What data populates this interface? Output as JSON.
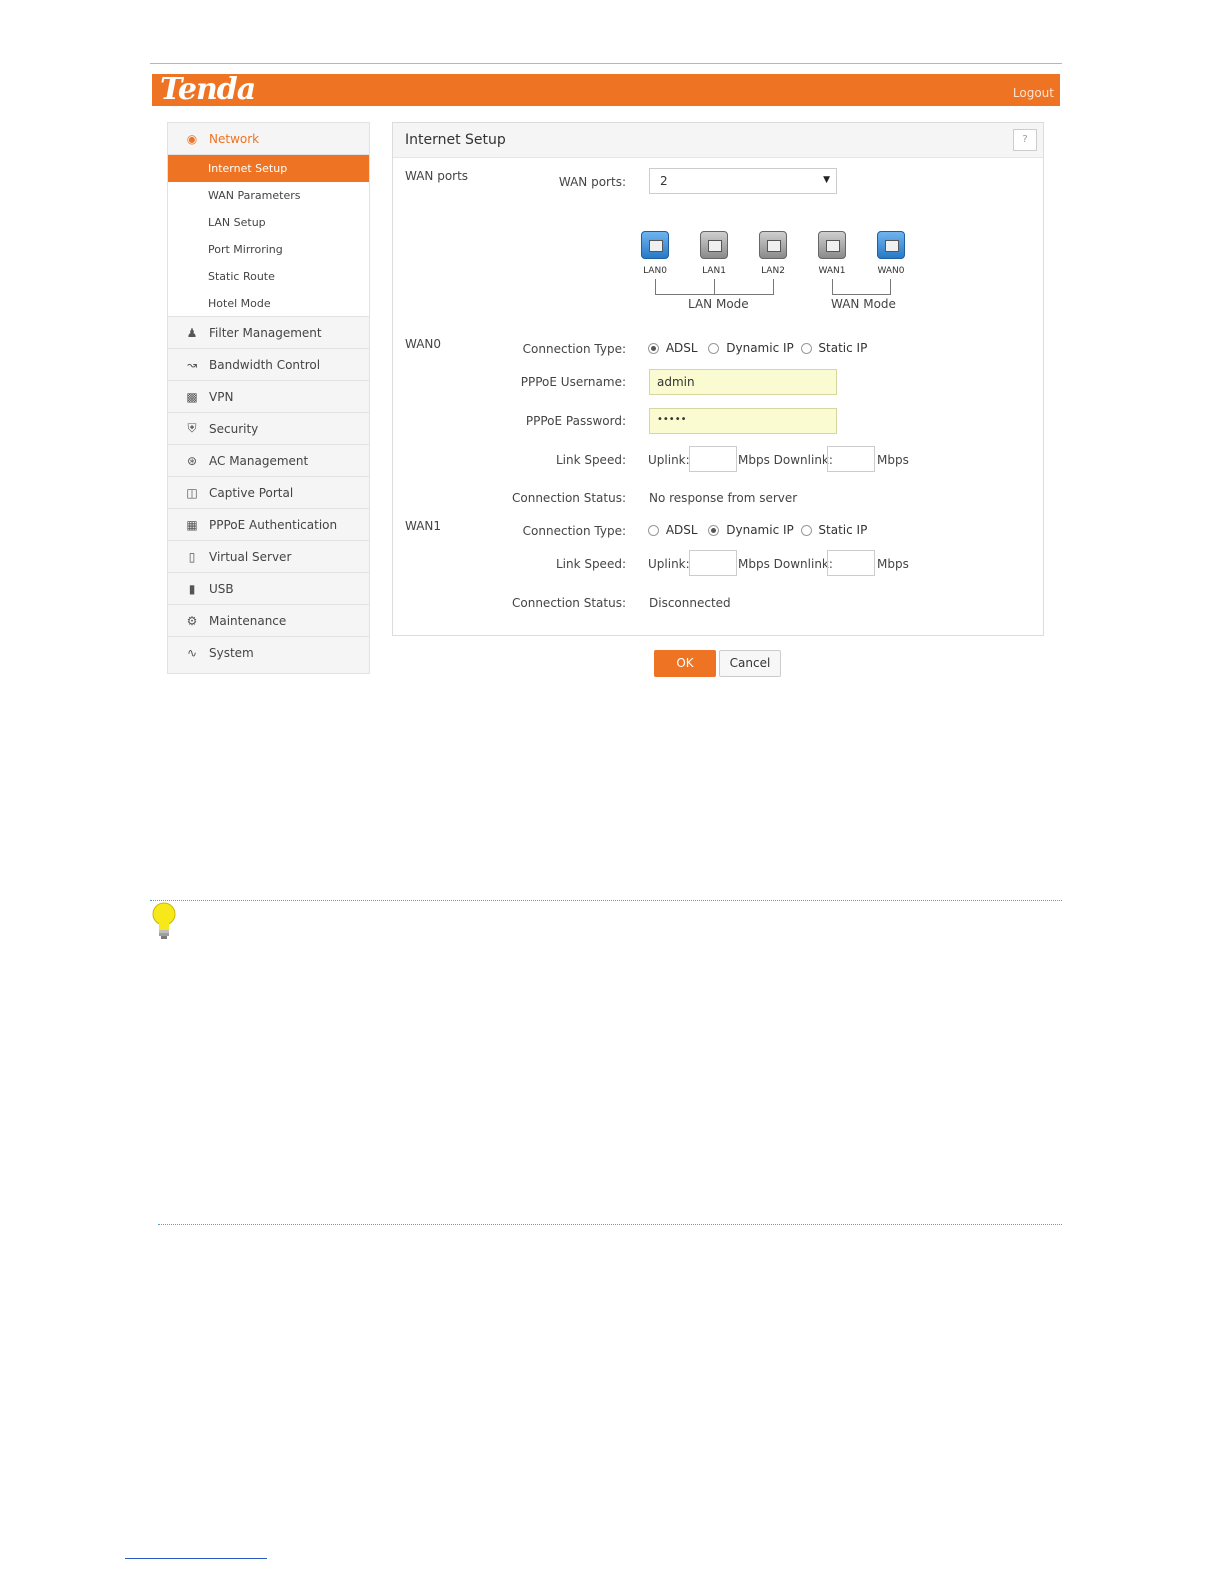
{
  "header": {
    "logo_text": "Tenda",
    "logout_label": "Logout",
    "accent_color": "#ee7322"
  },
  "sidebar": {
    "network": {
      "label": "Network",
      "icon": "globe-icon"
    },
    "network_items": [
      {
        "label": "Internet Setup",
        "active": true
      },
      {
        "label": "WAN Parameters"
      },
      {
        "label": "LAN Setup"
      },
      {
        "label": "Port Mirroring"
      },
      {
        "label": "Static Route"
      },
      {
        "label": "Hotel Mode"
      }
    ],
    "groups": [
      {
        "label": "Filter Management",
        "icon": "users-icon"
      },
      {
        "label": "Bandwidth Control",
        "icon": "chart-line-icon"
      },
      {
        "label": "VPN",
        "icon": "monitor-icon"
      },
      {
        "label": "Security",
        "icon": "shield-icon"
      },
      {
        "label": "AC Management",
        "icon": "satellite-icon"
      },
      {
        "label": "Captive Portal",
        "icon": "portal-icon"
      },
      {
        "label": "PPPoE Authentication",
        "icon": "auth-icon"
      },
      {
        "label": "Virtual Server",
        "icon": "server-icon"
      },
      {
        "label": "USB",
        "icon": "usb-icon"
      },
      {
        "label": "Maintenance",
        "icon": "gears-icon"
      },
      {
        "label": "System",
        "icon": "pulse-icon"
      }
    ]
  },
  "panel": {
    "title": "Internet Setup",
    "help_label": "?",
    "wan_ports_section": "WAN ports",
    "wan_ports_label": "WAN ports:",
    "wan_ports_value": "2",
    "ports": [
      {
        "label": "LAN0",
        "color": "blue"
      },
      {
        "label": "LAN1",
        "color": "gray"
      },
      {
        "label": "LAN2",
        "color": "gray"
      },
      {
        "label": "WAN1",
        "color": "gray"
      },
      {
        "label": "WAN0",
        "color": "blue"
      }
    ],
    "lan_mode_label": "LAN Mode",
    "wan_mode_label": "WAN Mode",
    "wan0": {
      "section": "WAN0",
      "connection_type_label": "Connection Type:",
      "options": [
        "ADSL",
        "Dynamic IP",
        "Static IP"
      ],
      "selected": "ADSL",
      "username_label": "PPPoE Username:",
      "username_value": "admin",
      "password_label": "PPPoE Password:",
      "password_value": "•••••",
      "link_speed_label": "Link Speed:",
      "uplink_label": "Uplink:",
      "mbps_downlink_label": "Mbps Downlink:",
      "mbps_label": "Mbps",
      "status_label": "Connection Status:",
      "status_value": "No response from server"
    },
    "wan1": {
      "section": "WAN1",
      "connection_type_label": "Connection Type:",
      "options": [
        "ADSL",
        "Dynamic IP",
        "Static IP"
      ],
      "selected": "Dynamic IP",
      "link_speed_label": "Link Speed:",
      "uplink_label": "Uplink:",
      "mbps_downlink_label": "Mbps Downlink:",
      "mbps_label": "Mbps",
      "status_label": "Connection Status:",
      "status_value": "Disconnected"
    }
  },
  "buttons": {
    "ok": "OK",
    "cancel": "Cancel"
  }
}
